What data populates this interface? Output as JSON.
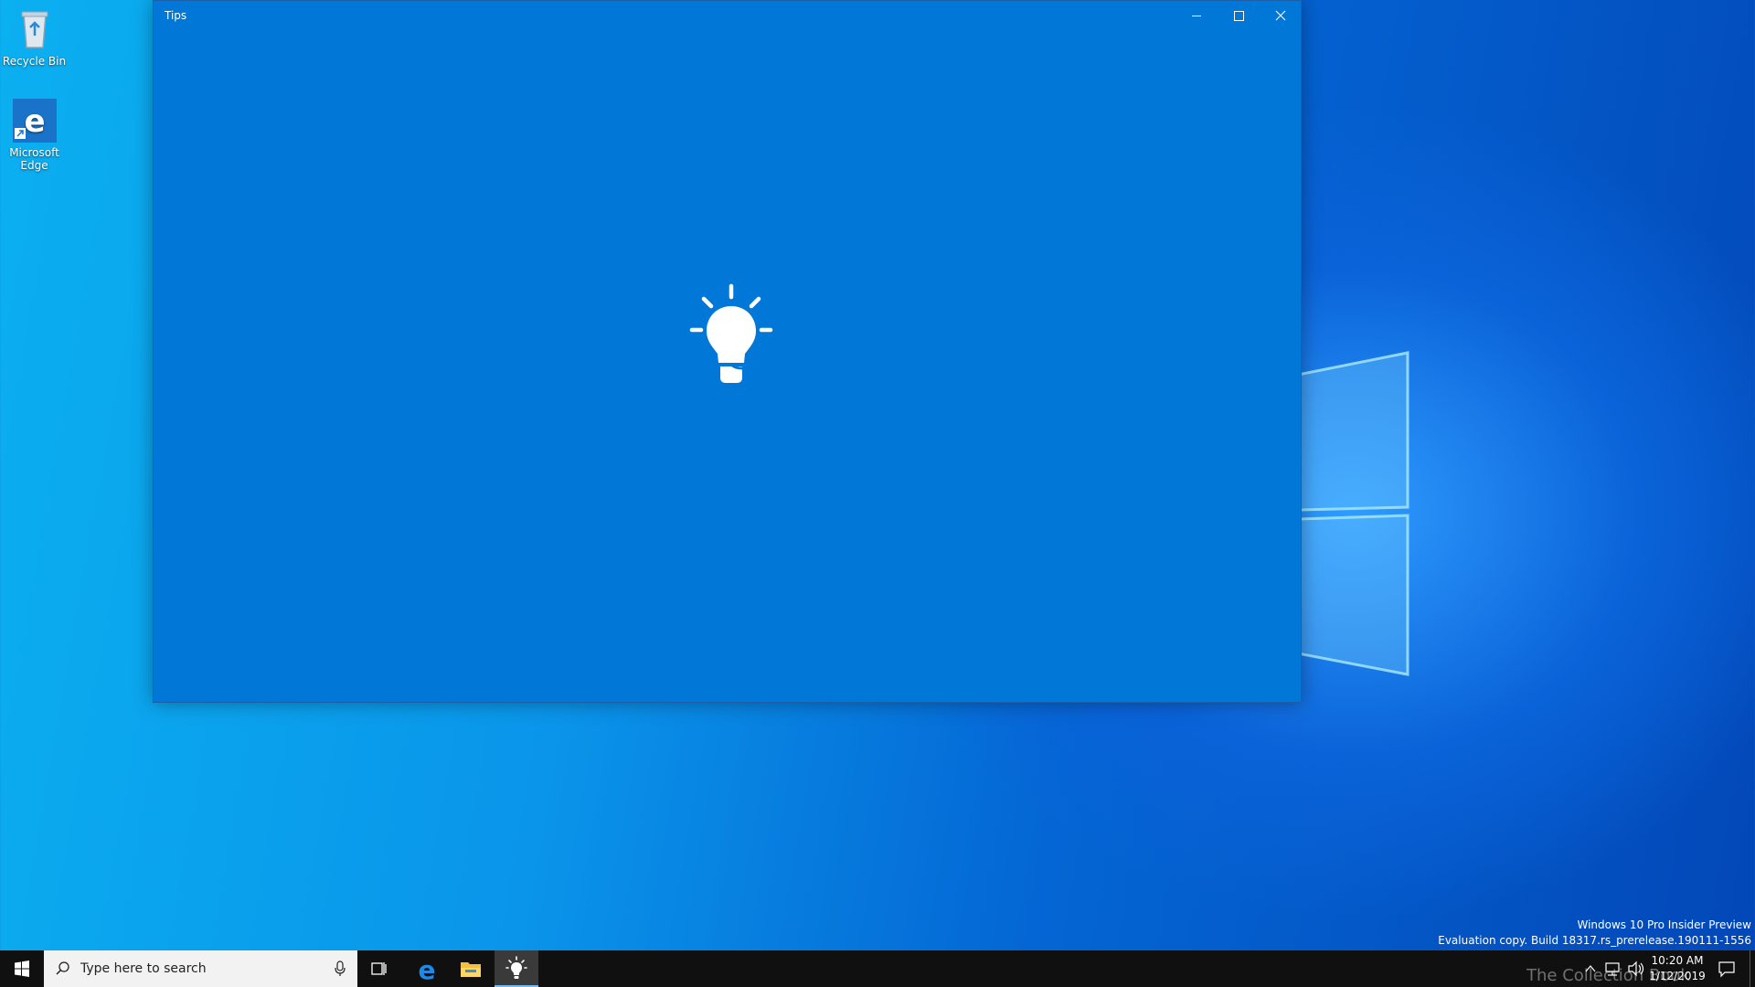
{
  "desktop": {
    "icons": [
      {
        "label": "Recycle Bin",
        "icon": "recycle-bin-icon"
      },
      {
        "label": "Microsoft Edge",
        "icon": "edge-icon"
      }
    ]
  },
  "window": {
    "title": "Tips",
    "bg_color": "#0178d7",
    "splash_icon": "lightbulb-icon"
  },
  "taskbar": {
    "search_placeholder": "Type here to search",
    "apps": [
      {
        "icon": "task-view-icon"
      },
      {
        "icon": "edge-icon"
      },
      {
        "icon": "file-explorer-icon"
      },
      {
        "icon": "tips-icon",
        "active": true
      }
    ],
    "clock": {
      "time": "10:20 AM",
      "date": "1/12/2019"
    }
  },
  "watermark": {
    "line1": "Windows 10 Pro Insider Preview",
    "line2": "Evaluation copy. Build 18317.rs_prerelease.190111-1556",
    "brand": "The Collection Book"
  }
}
